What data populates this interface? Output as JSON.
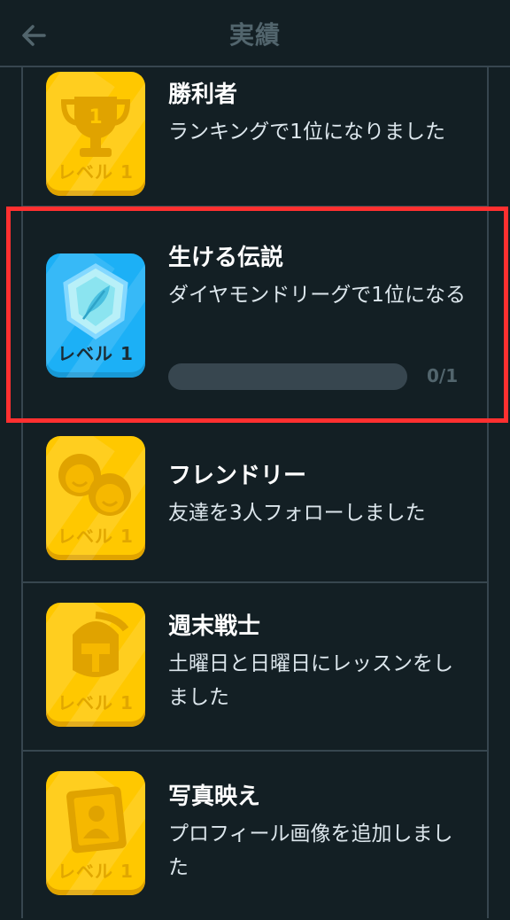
{
  "header": {
    "title": "実績",
    "back_icon": "arrow-left-icon"
  },
  "achievements": [
    {
      "name": "勝利者",
      "description": "ランキングで1位になりました",
      "level": "レベル 1",
      "icon": "trophy-icon",
      "badge_color": "#ffc800"
    },
    {
      "name": "生ける伝説",
      "description": "ダイヤモンドリーグで1位になる",
      "level": "レベル 1",
      "icon": "diamond-feather-icon",
      "badge_color": "#1cb0f6",
      "progress_text": "0/1",
      "progress_value": 0
    },
    {
      "name": "フレンドリー",
      "description": "友達を3人フォローしました",
      "level": "レベル 1",
      "icon": "friends-icon",
      "badge_color": "#ffc800"
    },
    {
      "name": "週末戦士",
      "description": "土曜日と日曜日にレッスンをしました",
      "level": "レベル 1",
      "icon": "warrior-helmet-icon",
      "badge_color": "#ffc800"
    },
    {
      "name": "写真映え",
      "description": "プロフィール画像を追加しました",
      "level": "レベル 1",
      "icon": "profile-photo-icon",
      "badge_color": "#ffc800"
    }
  ],
  "colors": {
    "background": "#131f24",
    "divider": "#37464f",
    "highlight": "#ff3030"
  }
}
